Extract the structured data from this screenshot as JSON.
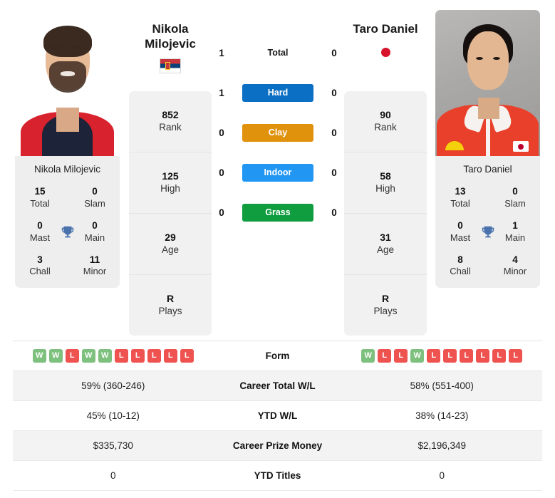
{
  "players": {
    "left": {
      "name": "Nikola Milojevic",
      "name_line1": "Nikola",
      "name_line2": "Milojevic",
      "flag": "serbia-flag",
      "panel_name": "Nikola Milojevic",
      "titles": [
        {
          "value": "15",
          "label": "Total"
        },
        {
          "value": "0",
          "label": "Slam"
        },
        {
          "value": "0",
          "label": "Mast"
        },
        {
          "value": "0",
          "label": "Main"
        },
        {
          "value": "3",
          "label": "Chall"
        },
        {
          "value": "11",
          "label": "Minor"
        }
      ],
      "ranks": [
        {
          "value": "852",
          "label": "Rank"
        },
        {
          "value": "125",
          "label": "High"
        },
        {
          "value": "29",
          "label": "Age"
        },
        {
          "value": "R",
          "label": "Plays"
        }
      ],
      "h2h": {
        "total": "1",
        "hard": "1",
        "clay": "0",
        "indoor": "0",
        "grass": "0"
      },
      "form": [
        "W",
        "W",
        "L",
        "W",
        "W",
        "L",
        "L",
        "L",
        "L",
        "L"
      ],
      "career_total_wl": "59% (360-246)",
      "ytd_wl": "45% (10-12)",
      "career_prize_money": "$335,730",
      "ytd_titles": "0"
    },
    "right": {
      "name": "Taro Daniel",
      "name_line1": "Taro Daniel",
      "name_line2": "",
      "flag": "japan-flag",
      "panel_name": "Taro Daniel",
      "titles": [
        {
          "value": "13",
          "label": "Total"
        },
        {
          "value": "0",
          "label": "Slam"
        },
        {
          "value": "0",
          "label": "Mast"
        },
        {
          "value": "1",
          "label": "Main"
        },
        {
          "value": "8",
          "label": "Chall"
        },
        {
          "value": "4",
          "label": "Minor"
        }
      ],
      "ranks": [
        {
          "value": "90",
          "label": "Rank"
        },
        {
          "value": "58",
          "label": "High"
        },
        {
          "value": "31",
          "label": "Age"
        },
        {
          "value": "R",
          "label": "Plays"
        }
      ],
      "h2h": {
        "total": "0",
        "hard": "0",
        "clay": "0",
        "indoor": "0",
        "grass": "0"
      },
      "form": [
        "W",
        "L",
        "L",
        "W",
        "L",
        "L",
        "L",
        "L",
        "L",
        "L"
      ],
      "career_total_wl": "58% (551-400)",
      "ytd_wl": "38% (14-23)",
      "career_prize_money": "$2,196,349",
      "ytd_titles": "0"
    }
  },
  "h2h_labels": {
    "total": "Total",
    "hard": "Hard",
    "clay": "Clay",
    "indoor": "Indoor",
    "grass": "Grass"
  },
  "table_labels": {
    "form": "Form",
    "career_total_wl": "Career Total W/L",
    "ytd_wl": "YTD W/L",
    "career_prize_money": "Career Prize Money",
    "ytd_titles": "YTD Titles"
  },
  "colors": {
    "hard": "#0b6fc4",
    "clay": "#e0920c",
    "indoor": "#2196f3",
    "grass": "#0f9d3f",
    "win": "#7ec07e",
    "loss": "#ef5350",
    "trophy": "#4a72ad",
    "panel_bg": "#eeeeee",
    "card_bg": "#f1f1f1",
    "row_alt_bg": "#f3f3f3"
  }
}
